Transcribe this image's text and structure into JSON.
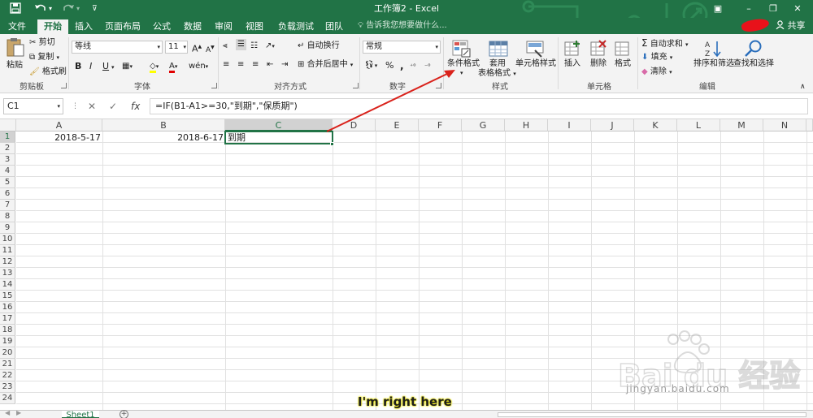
{
  "titlebar": {
    "title": "工作簿2 - Excel",
    "quick_access": {
      "save_icon": "save-icon",
      "undo_icon": "undo-icon",
      "redo_icon": "redo-icon",
      "customize_icon": "customize-icon"
    },
    "minimize": "–",
    "restore": "❐",
    "close": "✕"
  },
  "tabs": [
    "文件",
    "开始",
    "插入",
    "页面布局",
    "公式",
    "数据",
    "审阅",
    "视图",
    "负载测试",
    "团队"
  ],
  "tell_me": "告诉我您想要做什么...",
  "share_label": "共享",
  "ribbon": {
    "clipboard": {
      "paste": "粘贴",
      "cut": "剪切",
      "copy": "复制",
      "format_painter": "格式刷",
      "label": "剪贴板"
    },
    "font": {
      "font_name": "等线",
      "font_size": "11",
      "grow": "A",
      "shrink": "A",
      "bold": "B",
      "italic": "I",
      "underline": "U",
      "label": "字体"
    },
    "alignment": {
      "wrap": "自动换行",
      "merge": "合并后居中",
      "label": "对齐方式"
    },
    "number": {
      "format": "常规",
      "percent": "%",
      "comma": ",",
      "label": "数字"
    },
    "styles": {
      "conditional": "条件格式",
      "table": "套用\n表格格式",
      "cell_styles": "单元格样式",
      "label": "样式"
    },
    "cells": {
      "insert": "插入",
      "delete": "删除",
      "format": "格式",
      "label": "单元格"
    },
    "editing": {
      "autosum": "自动求和",
      "fill": "填充",
      "clear": "清除",
      "sort": "排序和筛选",
      "find": "查找和选择",
      "label": "编辑"
    }
  },
  "formula_bar": {
    "name_box": "C1",
    "fx": "fx",
    "formula": "=IF(B1-A1>=30,\"到期\",\"保质期\")"
  },
  "columns": [
    "A",
    "B",
    "C",
    "D",
    "E",
    "F",
    "G",
    "H",
    "I",
    "J",
    "K",
    "L",
    "M",
    "N"
  ],
  "rows": [
    "1",
    "2",
    "3",
    "4",
    "5",
    "6",
    "7",
    "8",
    "9",
    "10",
    "11",
    "12",
    "13",
    "14",
    "15",
    "16",
    "17",
    "18",
    "19",
    "20",
    "21",
    "22",
    "23",
    "24"
  ],
  "cells": {
    "A1": "2018-5-17",
    "B1": "2018-6-17",
    "C1": "到期"
  },
  "sheet_tab": "Sheet1",
  "caption": "I'm right here",
  "watermark": {
    "logo": "Bai du 经验",
    "url": "jingyan.baidu.com"
  }
}
